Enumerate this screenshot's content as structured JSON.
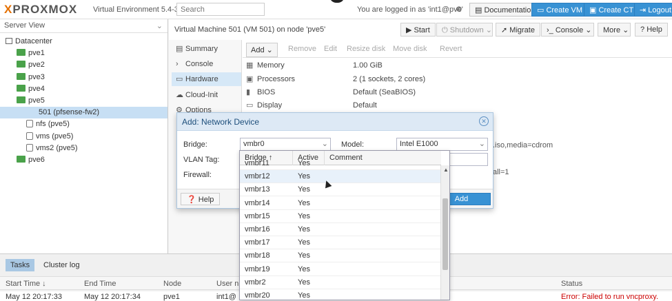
{
  "header": {
    "logo_x": "X",
    "logo_rest": "PROXMOX",
    "version": "Virtual Environment 5.4-3",
    "search_placeholder": "Search",
    "login_text": "You are logged in as 'int1@pve'",
    "documentation": "Documentation",
    "create_vm": "Create VM",
    "create_ct": "Create CT",
    "logout": "Logout"
  },
  "left": {
    "view": "Server View",
    "tree": [
      {
        "label": "Datacenter",
        "type": "dc"
      },
      {
        "label": "pve1",
        "type": "node"
      },
      {
        "label": "pve2",
        "type": "node"
      },
      {
        "label": "pve3",
        "type": "node"
      },
      {
        "label": "pve4",
        "type": "node"
      },
      {
        "label": "pve5",
        "type": "node"
      },
      {
        "label": "501 (pfsense-fw2)",
        "type": "vm"
      },
      {
        "label": "nfs (pve5)",
        "type": "store"
      },
      {
        "label": "vms (pve5)",
        "type": "store"
      },
      {
        "label": "vms2 (pve5)",
        "type": "store"
      },
      {
        "label": "pve6",
        "type": "node"
      }
    ]
  },
  "main": {
    "title": "Virtual Machine 501 (VM 501) on node 'pve5'",
    "toolbar": {
      "start": "Start",
      "shutdown": "Shutdown",
      "migrate": "Migrate",
      "console": "Console",
      "more": "More",
      "help": "Help"
    },
    "subnav": [
      "Summary",
      "Console",
      "Hardware",
      "Cloud-Init",
      "Options"
    ],
    "hw_toolbar": [
      "Add",
      "Remove",
      "Edit",
      "Resize disk",
      "Move disk",
      "Revert"
    ],
    "hardware": [
      {
        "key": "Memory",
        "value": "1.00 GiB"
      },
      {
        "key": "Processors",
        "value": "2 (1 sockets, 2 cores)"
      },
      {
        "key": "BIOS",
        "value": "Default (SeaBIOS)"
      },
      {
        "key": "Display",
        "value": "Default"
      }
    ],
    "partial_values": [
      ".iso,media=cdrom",
      "all=1"
    ]
  },
  "dialog": {
    "title": "Add: Network Device",
    "bridge_label": "Bridge:",
    "bridge_value": "vmbr0",
    "vlan_label": "VLAN Tag:",
    "firewall_label": "Firewall:",
    "model_label": "Model:",
    "model_value": "Intel E1000",
    "help": "Help",
    "add": "Add"
  },
  "picker": {
    "columns": [
      "Bridge ↑",
      "Active",
      "Comment"
    ],
    "rows": [
      {
        "bridge": "vmbr11",
        "active": "Yes"
      },
      {
        "bridge": "vmbr12",
        "active": "Yes"
      },
      {
        "bridge": "vmbr13",
        "active": "Yes"
      },
      {
        "bridge": "vmbr14",
        "active": "Yes"
      },
      {
        "bridge": "vmbr15",
        "active": "Yes"
      },
      {
        "bridge": "vmbr16",
        "active": "Yes"
      },
      {
        "bridge": "vmbr17",
        "active": "Yes"
      },
      {
        "bridge": "vmbr18",
        "active": "Yes"
      },
      {
        "bridge": "vmbr19",
        "active": "Yes"
      },
      {
        "bridge": "vmbr2",
        "active": "Yes"
      },
      {
        "bridge": "vmbr20",
        "active": "Yes"
      }
    ]
  },
  "bottom": {
    "tabs": [
      "Tasks",
      "Cluster log"
    ],
    "columns": [
      "Start Time ↓",
      "End Time",
      "Node",
      "User n",
      "Status"
    ],
    "row": {
      "start": "May 12 20:17:33",
      "end": "May 12 20:17:34",
      "node": "pve1",
      "user": "int1@",
      "status": "Error: Failed to run vncproxy."
    }
  }
}
